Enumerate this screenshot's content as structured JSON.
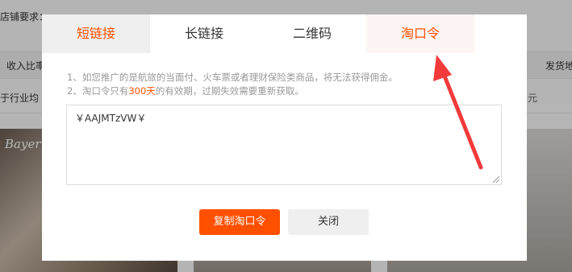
{
  "background": {
    "store_requirement": "店铺要求：",
    "income_ratio": "收入比率",
    "ship": "发货地",
    "industry_avg": "于行业均",
    "yuan": "元",
    "card_brand": "Bayer"
  },
  "modal": {
    "tabs": [
      {
        "label": "短链接"
      },
      {
        "label": "长链接"
      },
      {
        "label": "二维码"
      },
      {
        "label": "淘口令"
      }
    ],
    "notice_1": "1、如您推广的是航旅的当面付、火车票或者理财保险类商品，将无法获得佣金。",
    "notice_2_pre": "2、淘口令只有",
    "notice_2_hl": "300天",
    "notice_2_post": "的有效期，过期失效需要重新获取。",
    "code_value": "￥AAJMTzVW￥",
    "copy_button": "复制淘口令",
    "close_button": "关闭"
  },
  "colors": {
    "accent": "#ff5000",
    "annotation_arrow": "#f23a3a"
  }
}
